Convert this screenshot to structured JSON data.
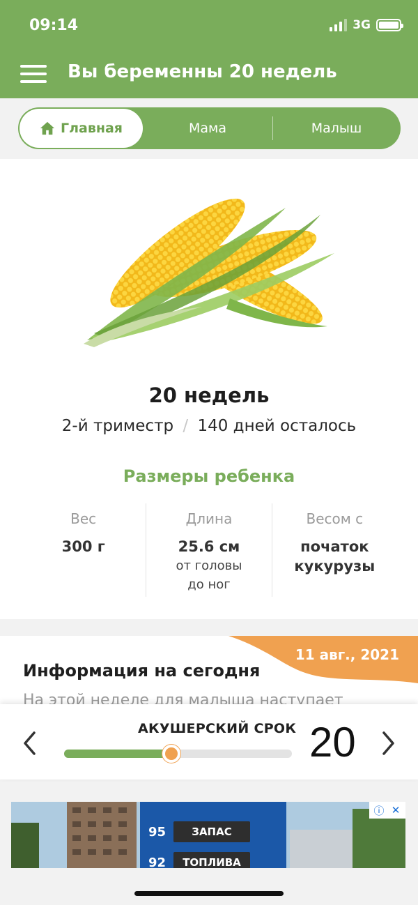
{
  "status_bar": {
    "time": "09:14",
    "network": "3G"
  },
  "header": {
    "title": "Вы беременны 20 недель"
  },
  "tabs": [
    {
      "label": "Главная",
      "active": true
    },
    {
      "label": "Мама",
      "active": false
    },
    {
      "label": "Малыш",
      "active": false
    }
  ],
  "summary": {
    "week_title": "20 недель",
    "trimester": "2-й триместр",
    "separator": "/",
    "days_left": "140 дней осталось"
  },
  "sizes": {
    "heading": "Размеры ребенка",
    "weight": {
      "label": "Вес",
      "value": "300 г"
    },
    "length": {
      "label": "Длина",
      "value": "25.6 см",
      "sub1": "от головы",
      "sub2": "до ног"
    },
    "compare": {
      "label": "Весом с",
      "value1": "початок",
      "value2": "кукурузы"
    }
  },
  "info": {
    "date": "11 авг., 2021",
    "title": "Информация на сегодня",
    "preview": "На этой неделе для малыша наступает"
  },
  "week_selector": {
    "label": "АКУШЕРСКИЙ СРОК",
    "week": "20",
    "progress_fraction": 0.47
  },
  "ad": {
    "rows": [
      {
        "price": "95",
        "text": "ЗАПАС"
      },
      {
        "price": "92",
        "text": "ТОПЛИВА"
      }
    ]
  },
  "colors": {
    "brand_green": "#7aad5b",
    "accent_orange": "#f0a150"
  }
}
